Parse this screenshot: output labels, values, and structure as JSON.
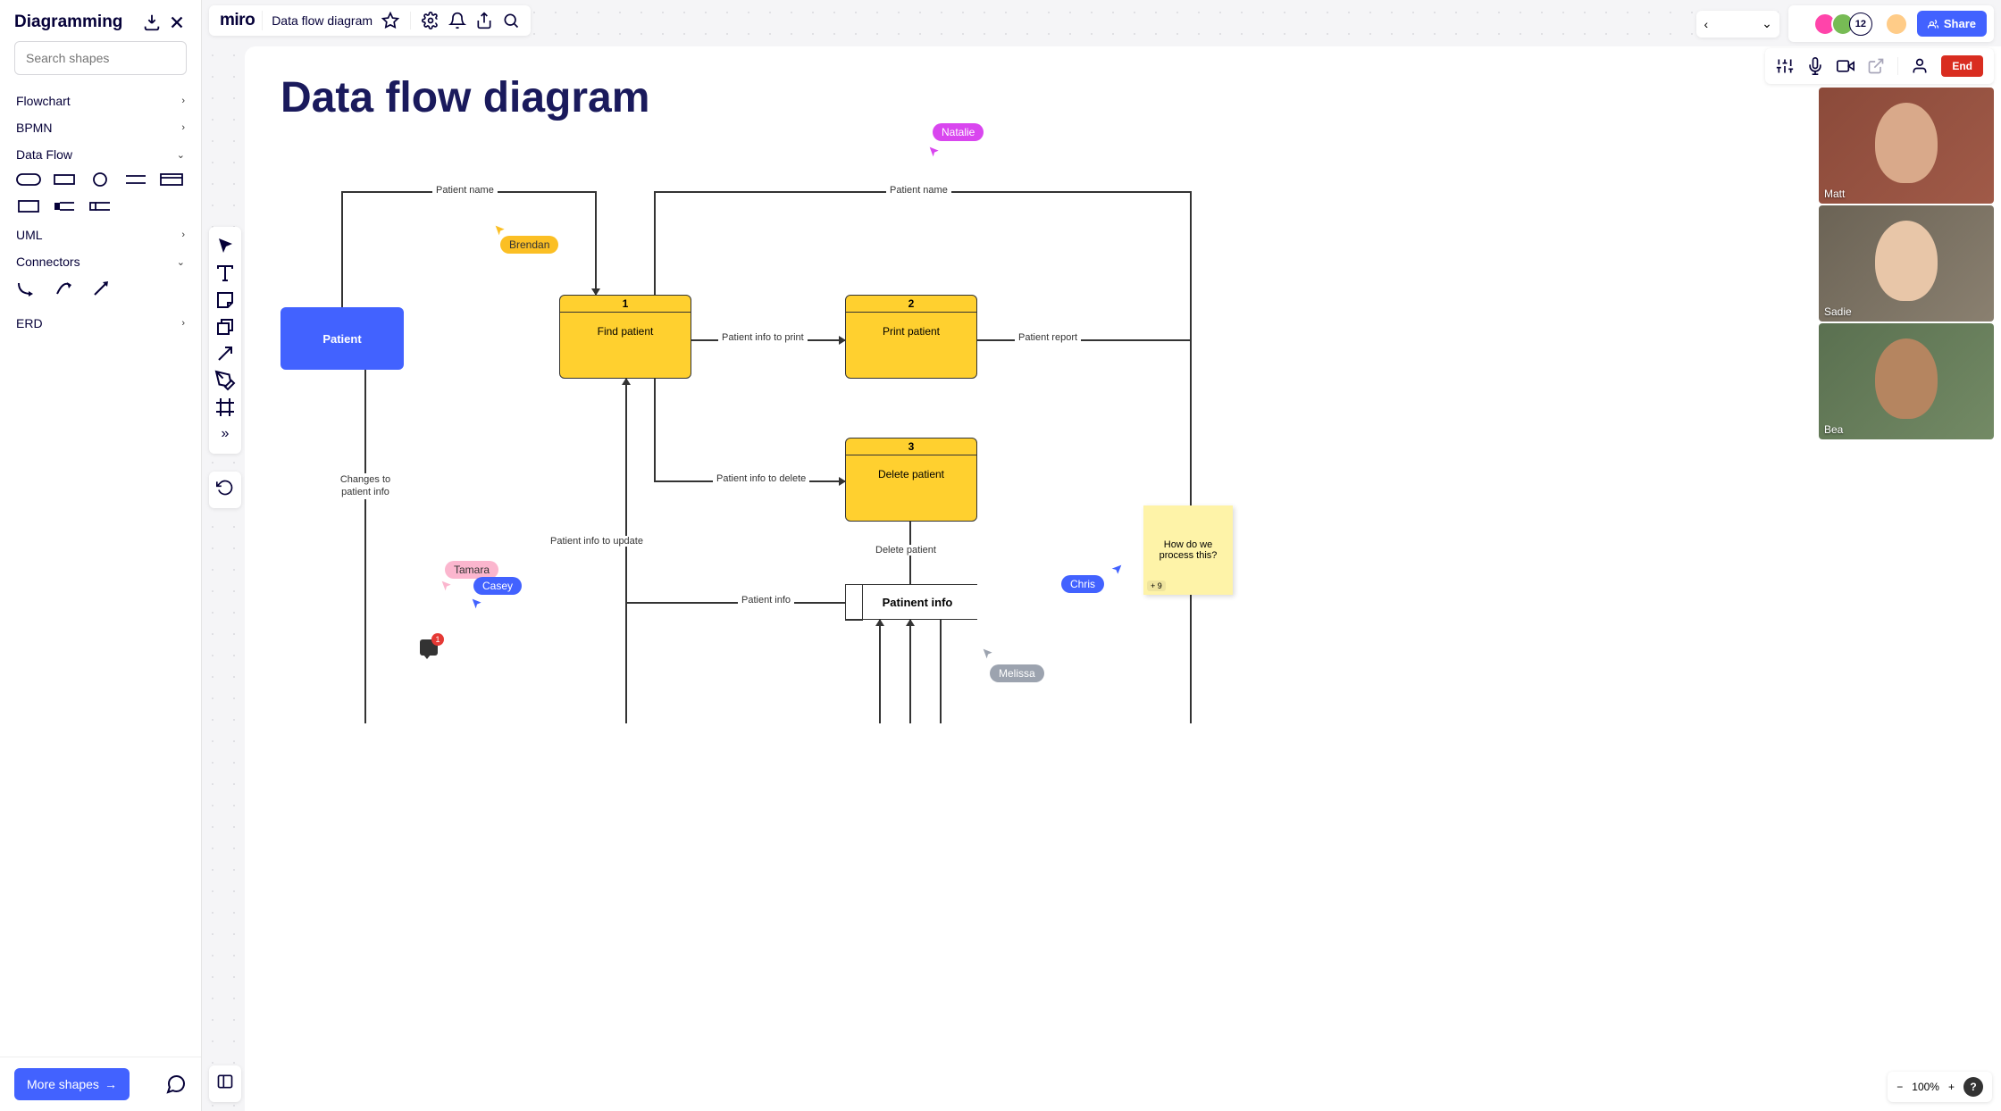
{
  "left_panel": {
    "title": "Diagramming",
    "search_placeholder": "Search shapes",
    "more_shapes_label": "More shapes",
    "categories": {
      "flowchart": "Flowchart",
      "bpmn": "BPMN",
      "dataflow": "Data Flow",
      "uml": "UML",
      "connectors": "Connectors",
      "erd": "ERD"
    }
  },
  "topbar": {
    "logo": "miro",
    "board_name": "Data flow diagram"
  },
  "collab": {
    "user_count": "12",
    "share_label": "Share"
  },
  "call": {
    "end_label": "End",
    "participants": [
      "Matt",
      "Sadie",
      "Bea"
    ]
  },
  "canvas": {
    "title": "Data flow diagram",
    "nodes": {
      "patient": "Patient",
      "find_patient": {
        "num": "1",
        "label": "Find patient"
      },
      "print_patient": {
        "num": "2",
        "label": "Print patient"
      },
      "delete_patient": {
        "num": "3",
        "label": "Delete patient"
      },
      "patient_info": "Patinent info"
    },
    "edges": {
      "patient_name_1": "Patient name",
      "patient_name_2": "Patient name",
      "changes": "Changes to patient info",
      "info_to_print": "Patient info to print",
      "info_to_delete": "Patient info to delete",
      "info_to_update": "Patient info to update",
      "patient_info": "Patient info",
      "delete_patient": "Delete patient",
      "patient_report": "Patient report"
    },
    "sticky": {
      "text": "How do we process this?",
      "count": "+ 9"
    },
    "comment_count": "1"
  },
  "cursors": {
    "brendan": "Brendan",
    "natalie": "Natalie",
    "tamara": "Tamara",
    "casey": "Casey",
    "chris": "Chris",
    "melissa": "Melissa"
  },
  "zoom": {
    "value": "100%"
  }
}
